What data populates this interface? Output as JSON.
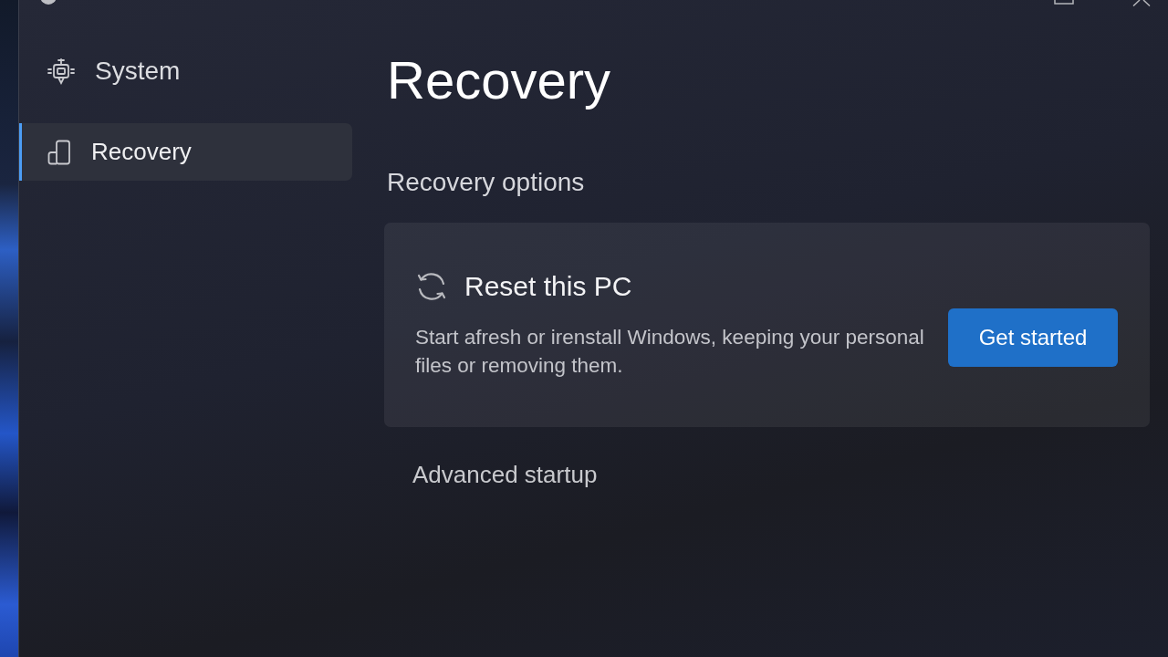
{
  "sidebar": {
    "items": [
      {
        "label": "System",
        "kind": "category",
        "selected": false
      },
      {
        "label": "Recovery",
        "kind": "page",
        "selected": true
      }
    ]
  },
  "page": {
    "title": "Recovery",
    "section_heading": "Recovery options"
  },
  "options": [
    {
      "kind": "card",
      "title": "Reset this PC",
      "description": "Start afresh or irenstall Windows, keeping your personal files or removing them.",
      "button": "Get started"
    },
    {
      "kind": "row",
      "title": "Advanced startup"
    }
  ]
}
